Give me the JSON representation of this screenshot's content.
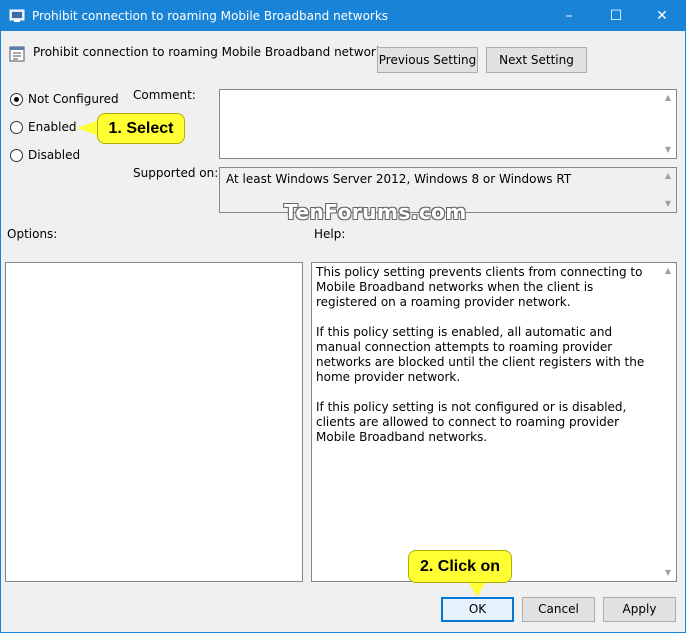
{
  "window": {
    "title": "Prohibit connection to roaming Mobile Broadband networks",
    "controls": {
      "minimize": "–",
      "maximize": "☐",
      "close": "✕"
    }
  },
  "header": {
    "policy_name": "Prohibit connection to roaming Mobile Broadband networks",
    "previous_label": "Previous Setting",
    "next_label": "Next Setting"
  },
  "state": {
    "options": [
      "Not Configured",
      "Enabled",
      "Disabled"
    ],
    "selected": "Not Configured"
  },
  "labels": {
    "comment": "Comment:",
    "supported_on": "Supported on:",
    "options": "Options:",
    "help": "Help:"
  },
  "supported_on_value": "At least Windows Server 2012, Windows 8 or Windows RT",
  "help_paragraphs": [
    "This policy setting prevents clients from connecting to Mobile Broadband networks when the client is registered on a roaming provider network.",
    "If this policy setting is enabled, all automatic and manual connection attempts to roaming provider networks are blocked until the client registers with the home provider network.",
    "If this policy setting is not configured or is disabled, clients are allowed to connect to roaming provider Mobile Broadband networks."
  ],
  "footer": {
    "ok": "OK",
    "cancel": "Cancel",
    "apply": "Apply"
  },
  "watermark": "TenForums.com",
  "annotations": {
    "step1": "1. Select",
    "step2": "2. Click on",
    "color": "#ffff33"
  },
  "colors": {
    "titlebar": "#1883d7",
    "focus_border": "#0078d7"
  }
}
